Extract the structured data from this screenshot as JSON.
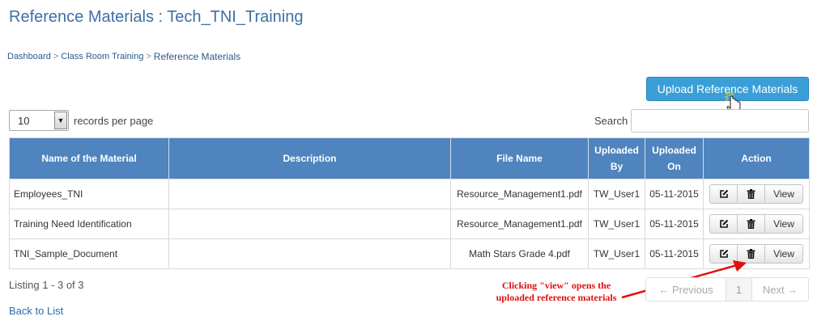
{
  "page": {
    "title": "Reference Materials : Tech_TNI_Training"
  },
  "breadcrumb": {
    "items": [
      "Dashboard",
      "Class Room Training",
      "Reference Materials"
    ]
  },
  "toolbar": {
    "upload_label": "Upload Reference Materials"
  },
  "records": {
    "per_page_value": "10",
    "per_page_label": "records per page"
  },
  "search": {
    "label": "Search",
    "value": "",
    "placeholder": ""
  },
  "table": {
    "headers": {
      "name": "Name of the Material",
      "description": "Description",
      "file": "File Name",
      "uploaded_by_1": "Uploaded",
      "uploaded_by_2": "By",
      "uploaded_on_1": "Uploaded",
      "uploaded_on_2": "On",
      "action": "Action"
    },
    "rows": [
      {
        "name": "Employees_TNI",
        "description": "",
        "file": "Resource_Management1.pdf",
        "uploaded_by": "TW_User1",
        "uploaded_on": "05-11-2015",
        "view_label": "View"
      },
      {
        "name": "Training Need Identification",
        "description": "",
        "file": "Resource_Management1.pdf",
        "uploaded_by": "TW_User1",
        "uploaded_on": "05-11-2015",
        "view_label": "View"
      },
      {
        "name": "TNI_Sample_Document",
        "description": "",
        "file": "Math Stars Grade 4.pdf",
        "uploaded_by": "TW_User1",
        "uploaded_on": "05-11-2015",
        "view_label": "View"
      }
    ]
  },
  "footer": {
    "listing": "Listing 1 - 3 of 3",
    "back_label": "Back to List"
  },
  "pagination": {
    "prev": "← Previous",
    "page": "1",
    "next": "Next →"
  },
  "annotation": {
    "line1": "Clicking \"view\" opens the",
    "line2": "uploaded reference materials"
  },
  "colors": {
    "header_bg": "#4f84be",
    "button_bg": "#3a9fd6",
    "title": "#3f6fa6",
    "annotation": "#e01010"
  },
  "icons": {
    "edit": "edit-icon",
    "delete": "trash-icon",
    "dropdown": "chevron-down-icon",
    "cursor": "hand-cursor-icon"
  }
}
